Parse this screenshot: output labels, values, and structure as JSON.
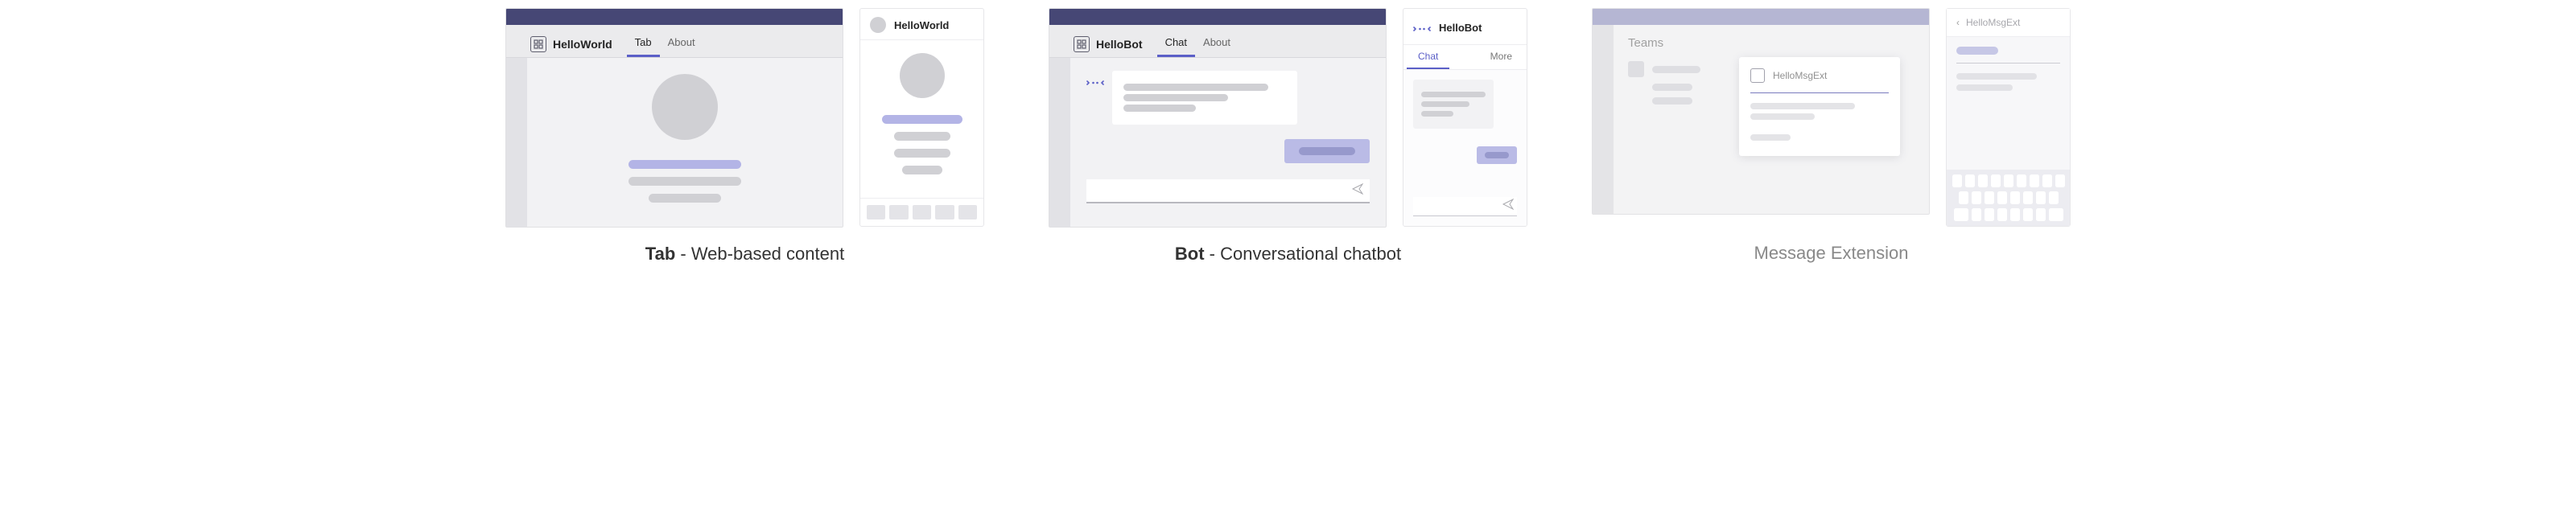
{
  "tab": {
    "app_name": "HelloWorld",
    "tabs": {
      "tab": "Tab",
      "about": "About"
    },
    "mobile_title": "HelloWorld",
    "caption_strong": "Tab",
    "caption_rest": " - Web-based content"
  },
  "bot": {
    "app_name": "HelloBot",
    "tabs": {
      "chat": "Chat",
      "about": "About"
    },
    "mobile_title": "HelloBot",
    "mobile_tabs": {
      "chat": "Chat",
      "more": "More"
    },
    "caption_strong": "Bot",
    "caption_rest": " - Conversational chatbot"
  },
  "msgext": {
    "panel_label": "Teams",
    "popup_title": "HelloMsgExt",
    "mobile_title": "HelloMsgExt",
    "caption": "Message Extension"
  }
}
